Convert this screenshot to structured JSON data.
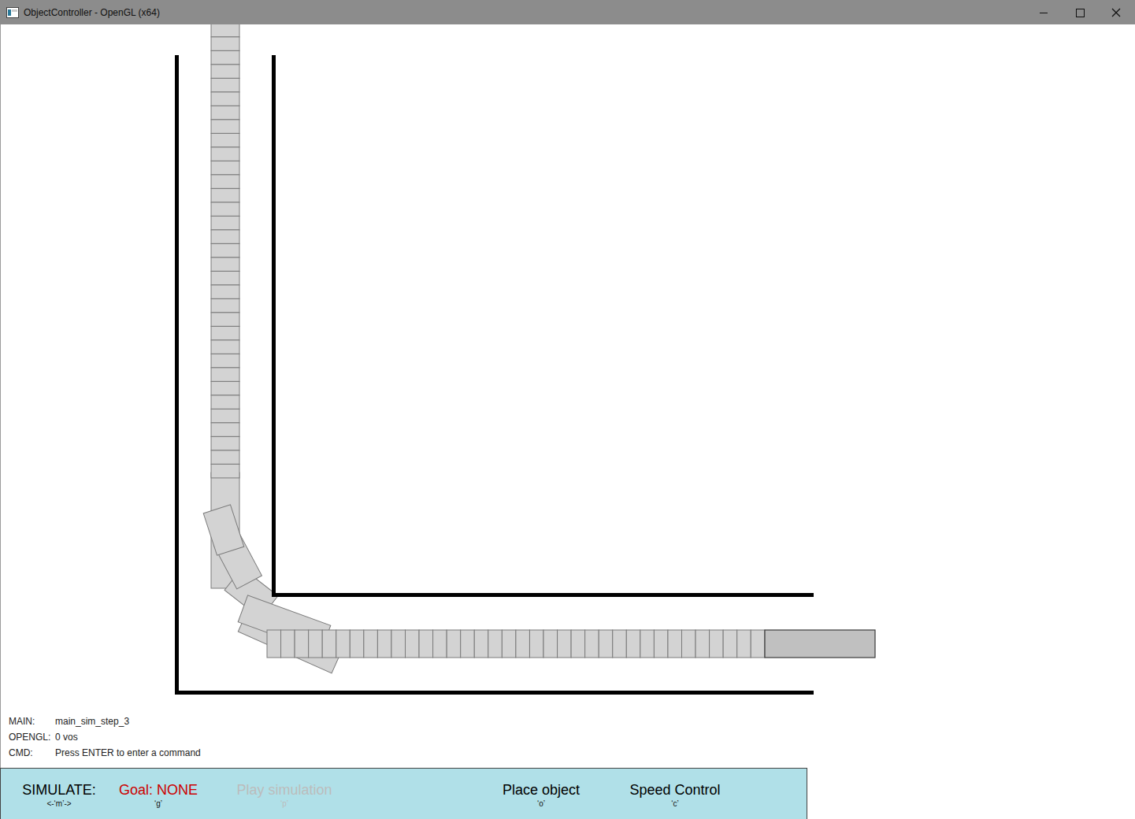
{
  "window": {
    "title": "ObjectController - OpenGL (x64)"
  },
  "status_lines": [
    {
      "label": "MAIN:",
      "value": "main_sim_step_3"
    },
    {
      "label": "OPENGL:",
      "value": "0 vos"
    },
    {
      "label": "CMD:",
      "value": "Press ENTER to enter a command"
    }
  ],
  "toolbar": {
    "items": [
      {
        "label": "SIMULATE:",
        "key": "<-‘m’->",
        "color": "#000000",
        "disabled": false
      },
      {
        "label": "Goal: NONE",
        "key": "‘g’",
        "color": "#cc0000",
        "disabled": false
      },
      {
        "label": "Play simulation",
        "key": "‘p’",
        "color": "#000000",
        "disabled": true
      },
      {
        "label": "Place object",
        "key": "‘o’",
        "color": "#000000",
        "disabled": false
      },
      {
        "label": "Speed Control",
        "key": "‘c’",
        "color": "#000000",
        "disabled": false
      }
    ]
  }
}
